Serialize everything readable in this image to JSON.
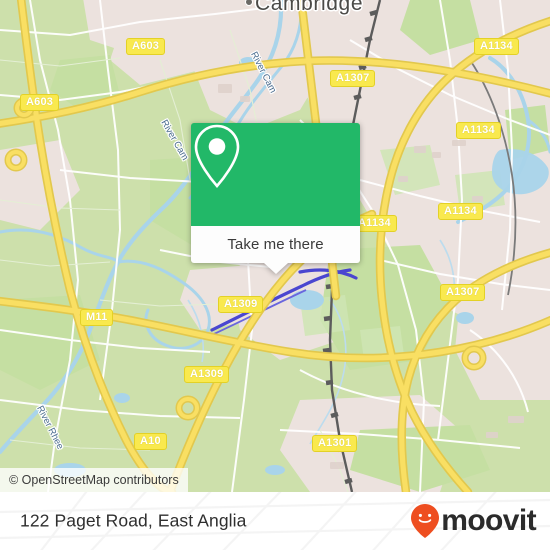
{
  "map": {
    "place_labels": [
      {
        "name": "Cambridge",
        "text": "Cambridge"
      }
    ],
    "water_labels": [
      {
        "text": "River Cam"
      },
      {
        "text": "River Cam"
      },
      {
        "text": "River Rhee"
      }
    ],
    "road_shields": [
      {
        "text": "A603"
      },
      {
        "text": "A603"
      },
      {
        "text": "A1307"
      },
      {
        "text": "A1134"
      },
      {
        "text": "A1134"
      },
      {
        "text": "A1134"
      },
      {
        "text": "A1134"
      },
      {
        "text": "A1307"
      },
      {
        "text": "A1309"
      },
      {
        "text": "A1309"
      },
      {
        "text": "M11"
      },
      {
        "text": "A10"
      },
      {
        "text": "A1301"
      }
    ],
    "attribution": "© OpenStreetMap contributors",
    "colors": {
      "farmland": "#cde0ab",
      "builtup": "#ece2de",
      "water": "#a9d4ea",
      "motorway": "#f9cf53",
      "trunk": "#f9e94e",
      "rail": "#5c5c5c",
      "cycle": "#4040cf"
    }
  },
  "popup": {
    "icon": "map-pin-icon",
    "action_label": "Take me there",
    "header_color": "#22b868"
  },
  "footer": {
    "title": "122 Paget Road, East Anglia",
    "brand_name": "moovit",
    "brand_icon": "moovit-smiley-pin-icon",
    "brand_color": "#ee4e20",
    "brand_text_color": "#2b2b2b"
  }
}
